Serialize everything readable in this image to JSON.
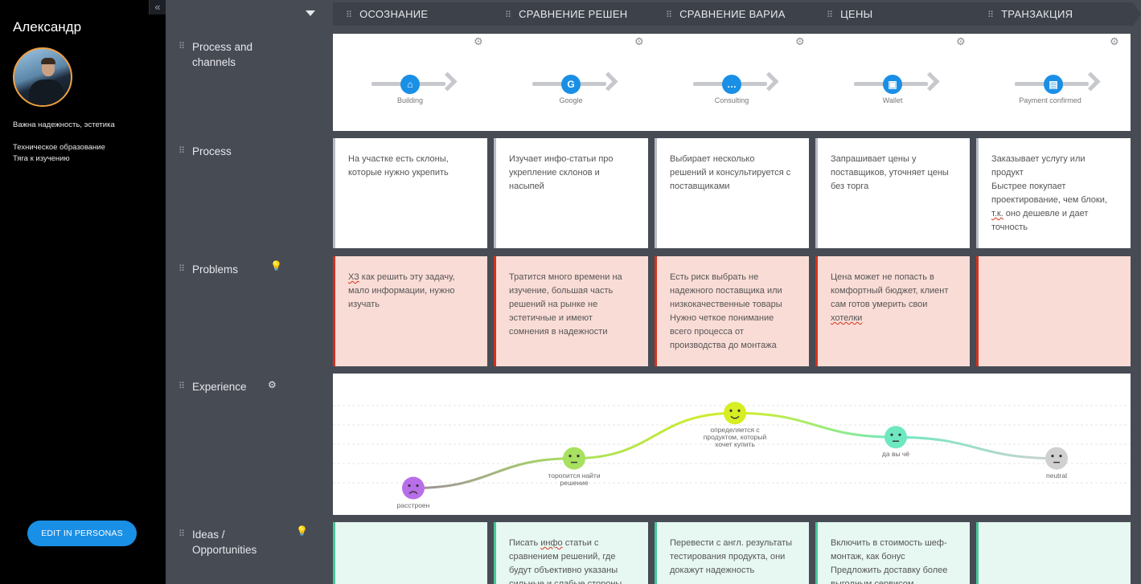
{
  "persona": {
    "name": "Александр",
    "notes": [
      "Важна надежность, эстетика",
      "Техническое образование",
      "Тяга к изучению"
    ],
    "edit_button": "EDIT IN PERSONAS",
    "collapse_icon": "«"
  },
  "stages": [
    "ОСОЗНАНИЕ",
    "СРАВНЕНИЕ РЕШЕН",
    "СРАВНЕНИЕ ВАРИА",
    "ЦЕНЫ",
    "ТРАНЗАКЦИЯ"
  ],
  "rows": {
    "channels": "Process and channels",
    "process": "Process",
    "problems": "Problems",
    "experience": "Experience",
    "ideas": "Ideas / Opportunities"
  },
  "channels": [
    {
      "icon": "home-icon",
      "glyph": "⌂",
      "label": "Building"
    },
    {
      "icon": "google-icon",
      "glyph": "G",
      "label": "Google"
    },
    {
      "icon": "chat-icon",
      "glyph": "…",
      "label": "Consulting"
    },
    {
      "icon": "wallet-icon",
      "glyph": "▣",
      "label": "Wallet"
    },
    {
      "icon": "payment-icon",
      "glyph": "▤",
      "label": "Payment confirmed"
    }
  ],
  "process": [
    [
      "На участке есть склоны,",
      "которые нужно укрепить"
    ],
    [
      "Изучает инфо-статьи про",
      "укрепление склонов и",
      "насыпей"
    ],
    [
      "Выбирает несколько",
      "решений и консультируется с",
      "поставщиками"
    ],
    [
      "Запрашивает цены у",
      "поставщиков, уточняет цены",
      "без торга"
    ],
    [
      "Заказывает услугу или",
      "продукт",
      "Быстрее покупает",
      "проектирование, чем блоки,",
      "т.к. оно дешевле и дает",
      "точность"
    ]
  ],
  "problems": [
    [
      "ХЗ как решить эту задачу,",
      "мало информации, нужно",
      "изучать"
    ],
    [
      "Тратится много времени на",
      "изучение, большая часть",
      "решений на рынке не",
      "эстетичные и имеют",
      "сомнения в надежности"
    ],
    [
      "Есть риск выбрать не",
      "надежного поставщика или",
      "низкокачественные товары",
      "Нужно четкое понимание",
      "всего процесса от",
      "производства до монтажа"
    ],
    [
      "Цена может не попасть в",
      "комфортный бюджет, клиент",
      "сам готов умерить свои",
      "хотелки"
    ],
    []
  ],
  "experience": {
    "points": [
      {
        "label": "расстроен",
        "level": 0.19,
        "color": "#b86ee8"
      },
      {
        "label": "торопится найти решение",
        "level": 0.4,
        "color": "#a8e060"
      },
      {
        "label": "определяется с продуктом, который хочет купить",
        "level": 0.72,
        "color": "#d6ee22"
      },
      {
        "label": "да вы чё",
        "level": 0.55,
        "color": "#6ee8c0"
      },
      {
        "label": "neutral",
        "level": 0.4,
        "color": "#d0d0d0"
      }
    ]
  },
  "ideas": [
    [],
    [
      "Писать инфо статьи с",
      "сравнением решений, где",
      "будут объективно указаны",
      "сильные и слабые стороны"
    ],
    [
      "Перевести с англ. результаты",
      "тестирования продукта, они",
      "докажут надежность"
    ],
    [
      "Включить в стоимость шеф-",
      "монтаж, как бонус",
      "Предложить доставку более",
      "выгодным сервисом"
    ],
    []
  ]
}
